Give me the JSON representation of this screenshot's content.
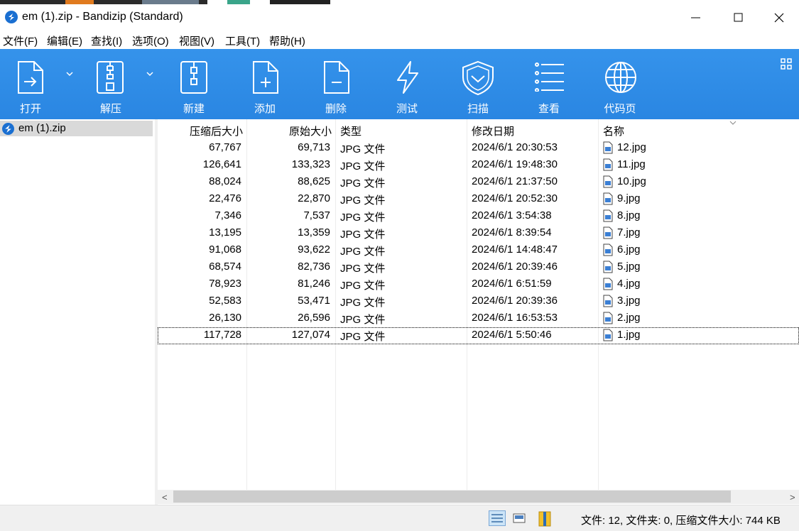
{
  "window": {
    "title": "em (1).zip - Bandizip (Standard)"
  },
  "menu": [
    {
      "label": "文件(F)"
    },
    {
      "label": "编辑(E)"
    },
    {
      "label": "查找(I)"
    },
    {
      "label": "选项(O)"
    },
    {
      "label": "视图(V)"
    },
    {
      "label": "工具(T)"
    },
    {
      "label": "帮助(H)"
    }
  ],
  "toolbar": {
    "buttons": [
      {
        "label": "打开",
        "icon": "open-archive-icon"
      },
      {
        "label": "解压",
        "icon": "extract-icon"
      },
      {
        "label": "新建",
        "icon": "new-archive-icon"
      },
      {
        "label": "添加",
        "icon": "add-file-icon"
      },
      {
        "label": "删除",
        "icon": "delete-file-icon"
      },
      {
        "label": "测试",
        "icon": "test-lightning-icon"
      },
      {
        "label": "扫描",
        "icon": "scan-shield-icon"
      },
      {
        "label": "查看",
        "icon": "view-list-icon"
      },
      {
        "label": "代码页",
        "icon": "codepage-globe-icon"
      }
    ],
    "color": "#2c8ae6"
  },
  "tree": {
    "root_label": "em (1).zip"
  },
  "list": {
    "columns": [
      "压缩后大小",
      "原始大小",
      "类型",
      "修改日期",
      "名称"
    ],
    "rows": [
      {
        "packed": "67,767",
        "size": "69,713",
        "type": "JPG 文件",
        "modified": "2024/6/1 20:30:53",
        "name": "12.jpg"
      },
      {
        "packed": "126,641",
        "size": "133,323",
        "type": "JPG 文件",
        "modified": "2024/6/1 19:48:30",
        "name": "11.jpg"
      },
      {
        "packed": "88,024",
        "size": "88,625",
        "type": "JPG 文件",
        "modified": "2024/6/1 21:37:50",
        "name": "10.jpg"
      },
      {
        "packed": "22,476",
        "size": "22,870",
        "type": "JPG 文件",
        "modified": "2024/6/1 20:52:30",
        "name": "9.jpg"
      },
      {
        "packed": "7,346",
        "size": "7,537",
        "type": "JPG 文件",
        "modified": "2024/6/1 3:54:38",
        "name": "8.jpg"
      },
      {
        "packed": "13,195",
        "size": "13,359",
        "type": "JPG 文件",
        "modified": "2024/6/1 8:39:54",
        "name": "7.jpg"
      },
      {
        "packed": "91,068",
        "size": "93,622",
        "type": "JPG 文件",
        "modified": "2024/6/1 14:48:47",
        "name": "6.jpg"
      },
      {
        "packed": "68,574",
        "size": "82,736",
        "type": "JPG 文件",
        "modified": "2024/6/1 20:39:46",
        "name": "5.jpg"
      },
      {
        "packed": "78,923",
        "size": "81,246",
        "type": "JPG 文件",
        "modified": "2024/6/1 6:51:59",
        "name": "4.jpg"
      },
      {
        "packed": "52,583",
        "size": "53,471",
        "type": "JPG 文件",
        "modified": "2024/6/1 20:39:36",
        "name": "3.jpg"
      },
      {
        "packed": "26,130",
        "size": "26,596",
        "type": "JPG 文件",
        "modified": "2024/6/1 16:53:53",
        "name": "2.jpg"
      },
      {
        "packed": "117,728",
        "size": "127,074",
        "type": "JPG 文件",
        "modified": "2024/6/1 5:50:46",
        "name": "1.jpg"
      }
    ]
  },
  "status": {
    "text": "文件: 12, 文件夹: 0, 压缩文件大小: 744 KB"
  }
}
